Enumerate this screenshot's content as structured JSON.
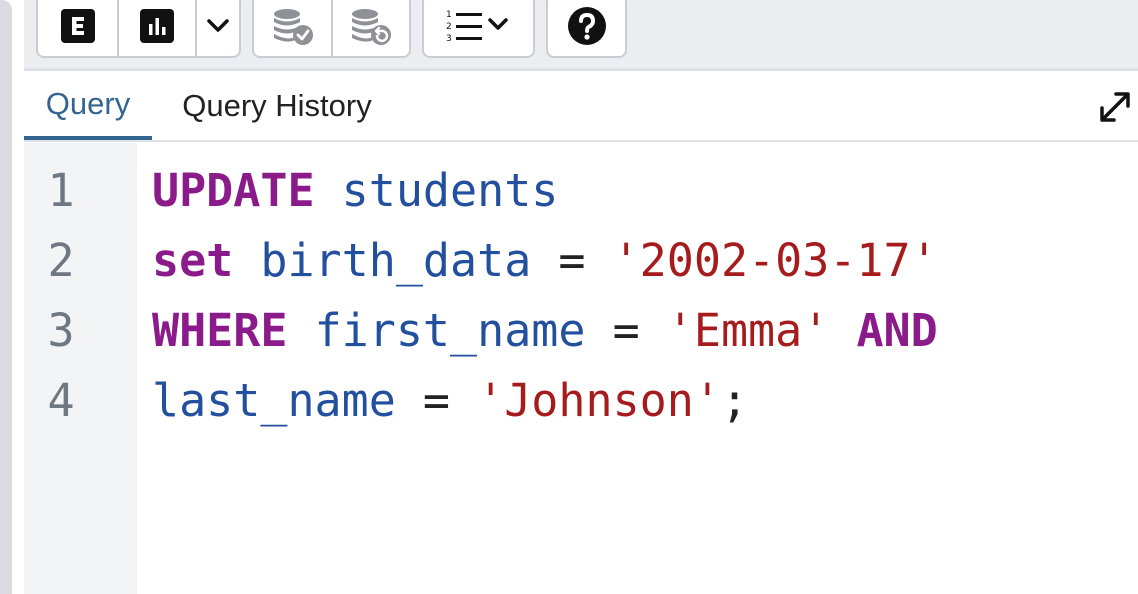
{
  "toolbar": {
    "buttons": [
      {
        "name": "explain-button",
        "icon": "explain-e-icon"
      },
      {
        "name": "explain-analyze-button",
        "icon": "bar-chart-icon"
      },
      {
        "name": "explain-options-dropdown",
        "icon": "chevron-down-icon"
      },
      {
        "name": "commit-button",
        "icon": "database-check-icon"
      },
      {
        "name": "rollback-button",
        "icon": "database-undo-icon"
      },
      {
        "name": "macros-dropdown",
        "icon": "numbered-list-icon"
      },
      {
        "name": "help-button",
        "icon": "help-circle-icon"
      }
    ]
  },
  "tabs": [
    {
      "label": "Query",
      "active": true
    },
    {
      "label": "Query History",
      "active": false
    }
  ],
  "editor": {
    "lines": [
      {
        "number": "1",
        "tokens": [
          {
            "t": "UPDATE",
            "k": "kw"
          },
          {
            "t": " ",
            "k": "op"
          },
          {
            "t": "students",
            "k": "id"
          }
        ]
      },
      {
        "number": "2",
        "tokens": [
          {
            "t": "set",
            "k": "kw"
          },
          {
            "t": " ",
            "k": "op"
          },
          {
            "t": "birth_data",
            "k": "id"
          },
          {
            "t": " = ",
            "k": "op"
          },
          {
            "t": "'2002-03-17'",
            "k": "str"
          }
        ]
      },
      {
        "number": "3",
        "tokens": [
          {
            "t": "WHERE",
            "k": "kw"
          },
          {
            "t": " ",
            "k": "op"
          },
          {
            "t": "first_name",
            "k": "id"
          },
          {
            "t": " = ",
            "k": "op"
          },
          {
            "t": "'Emma'",
            "k": "str"
          },
          {
            "t": " ",
            "k": "op"
          },
          {
            "t": "AND",
            "k": "kw"
          }
        ]
      },
      {
        "number": "4",
        "tokens": [
          {
            "t": "last_name",
            "k": "id"
          },
          {
            "t": " = ",
            "k": "op"
          },
          {
            "t": "'Johnson'",
            "k": "str"
          },
          {
            "t": ";",
            "k": "pn"
          }
        ]
      }
    ]
  },
  "colors": {
    "keyword": "#8b1a8b",
    "identifier": "#224f9e",
    "string": "#a61b1b",
    "active_tab": "#326690"
  }
}
